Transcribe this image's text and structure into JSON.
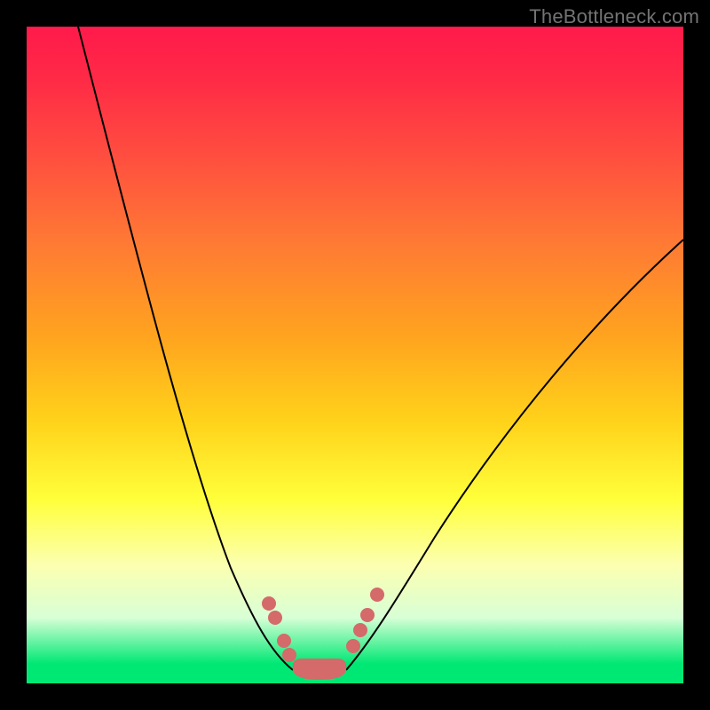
{
  "watermark": "TheBottleneck.com",
  "chart_data": {
    "type": "line",
    "title": "",
    "xlabel": "",
    "ylabel": "",
    "xlim": [
      0,
      100
    ],
    "ylim": [
      0,
      100
    ],
    "background_gradient": {
      "direction": "vertical",
      "stops": [
        {
          "pos": 0,
          "color": "#ff1a4b"
        },
        {
          "pos": 33,
          "color": "#ff7a34"
        },
        {
          "pos": 60,
          "color": "#ffd21a"
        },
        {
          "pos": 82,
          "color": "#fcffb0"
        },
        {
          "pos": 100,
          "color": "#00e874"
        }
      ]
    },
    "series": [
      {
        "name": "left-curve",
        "color": "#000000",
        "x": [
          8,
          16,
          24,
          31,
          37,
          41
        ],
        "y": [
          100,
          68,
          35,
          18,
          9,
          2
        ]
      },
      {
        "name": "right-curve",
        "color": "#000000",
        "x": [
          100,
          86,
          73,
          62,
          53,
          49
        ],
        "y": [
          68,
          55,
          39,
          22,
          9,
          2
        ]
      }
    ],
    "markers": {
      "color": "#d46a6a",
      "points": [
        {
          "x": 37,
          "y": 12
        },
        {
          "x": 38,
          "y": 10
        },
        {
          "x": 39,
          "y": 7
        },
        {
          "x": 40,
          "y": 4
        },
        {
          "x": 53,
          "y": 14
        },
        {
          "x": 52,
          "y": 11
        },
        {
          "x": 51,
          "y": 8
        },
        {
          "x": 50,
          "y": 5
        }
      ]
    },
    "bottom_band": {
      "color": "#00e874",
      "y_range": [
        0,
        3
      ]
    },
    "min_cluster": {
      "color": "#d46a6a",
      "x_range": [
        41,
        49
      ],
      "y": 2
    }
  }
}
